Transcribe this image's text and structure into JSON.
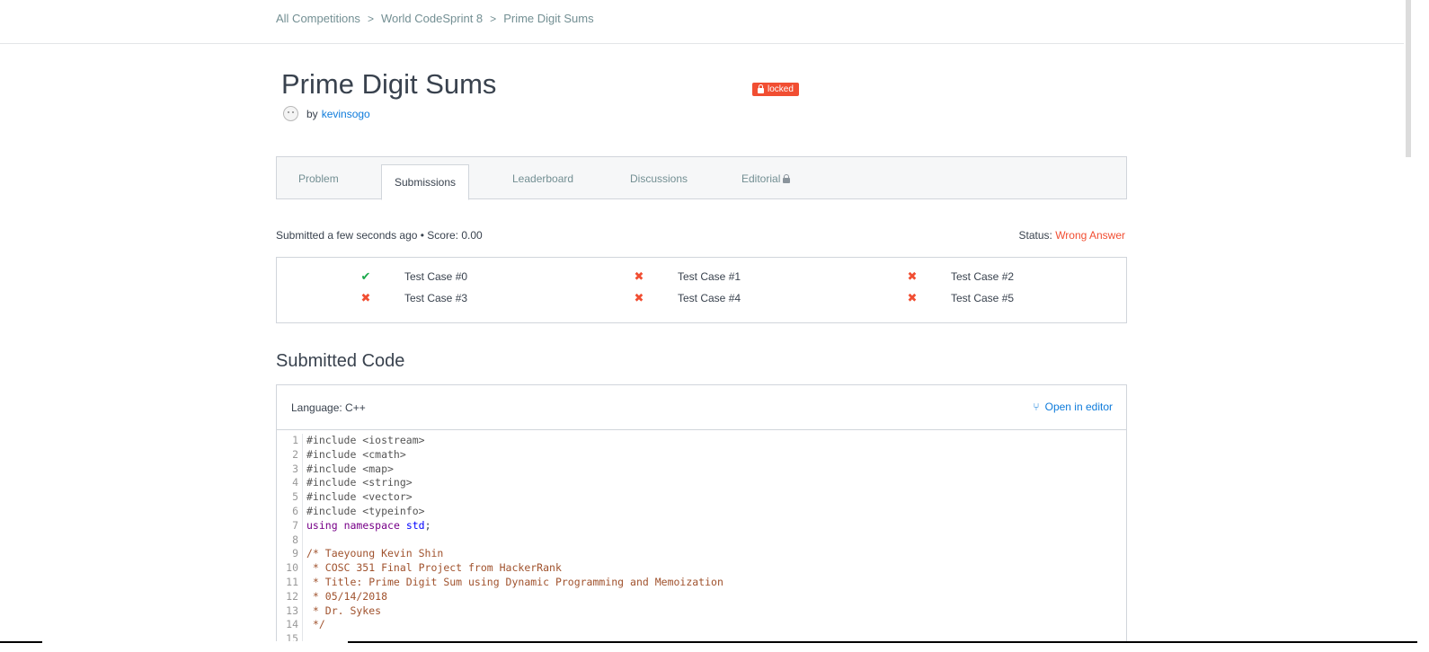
{
  "breadcrumb": {
    "items": [
      "All Competitions",
      "World CodeSprint 8",
      "Prime Digit Sums"
    ],
    "separator": ">"
  },
  "challenge": {
    "title": "Prime Digit Sums",
    "by_label": "by",
    "author": "kevinsogo",
    "badge": "locked"
  },
  "tabs": [
    {
      "label": "Problem",
      "active": false
    },
    {
      "label": "Submissions",
      "active": true
    },
    {
      "label": "Leaderboard",
      "active": false
    },
    {
      "label": "Discussions",
      "active": false
    },
    {
      "label": "Editorial",
      "active": false,
      "locked": true
    }
  ],
  "submission": {
    "submitted_text": "Submitted a few seconds ago • Score: 0.00",
    "status_label": "Status:",
    "status_value": "Wrong Answer"
  },
  "test_cases": [
    {
      "label": "Test Case #0",
      "result": "pass"
    },
    {
      "label": "Test Case #1",
      "result": "fail"
    },
    {
      "label": "Test Case #2",
      "result": "fail"
    },
    {
      "label": "Test Case #3",
      "result": "fail"
    },
    {
      "label": "Test Case #4",
      "result": "fail"
    },
    {
      "label": "Test Case #5",
      "result": "fail"
    }
  ],
  "code_section": {
    "heading": "Submitted Code",
    "language_label": "Language: C++",
    "open_editor_label": "Open in editor",
    "lines": [
      {
        "num": "1",
        "text": "#include <iostream>",
        "kind": "meta"
      },
      {
        "num": "2",
        "text": "#include <cmath>",
        "kind": "meta"
      },
      {
        "num": "3",
        "text": "#include <map>",
        "kind": "meta"
      },
      {
        "num": "4",
        "text": "#include <string>",
        "kind": "meta"
      },
      {
        "num": "5",
        "text": "#include <vector>",
        "kind": "meta"
      },
      {
        "num": "6",
        "text": "#include <typeinfo>",
        "kind": "meta"
      },
      {
        "num": "7",
        "text": "using namespace std;",
        "kind": "using"
      },
      {
        "num": "8",
        "text": "",
        "kind": "plain"
      },
      {
        "num": "9",
        "text": "/* Taeyoung Kevin Shin",
        "kind": "comment"
      },
      {
        "num": "10",
        "text": " * COSC 351 Final Project from HackerRank",
        "kind": "comment"
      },
      {
        "num": "11",
        "text": " * Title: Prime Digit Sum using Dynamic Programming and Memoization",
        "kind": "comment"
      },
      {
        "num": "12",
        "text": " * 05/14/2018",
        "kind": "comment"
      },
      {
        "num": "13",
        "text": " * Dr. Sykes",
        "kind": "comment"
      },
      {
        "num": "14",
        "text": " */",
        "kind": "comment"
      },
      {
        "num": "15",
        "text": "",
        "kind": "plain"
      }
    ]
  },
  "colors": {
    "accent_link": "#0e7bdb",
    "error": "#f14e32",
    "success": "#1ba94c",
    "text": "#39424e"
  },
  "icons": {
    "pass": "check-icon",
    "fail": "cross-icon",
    "lock": "lock-icon",
    "branch": "branch-icon"
  }
}
